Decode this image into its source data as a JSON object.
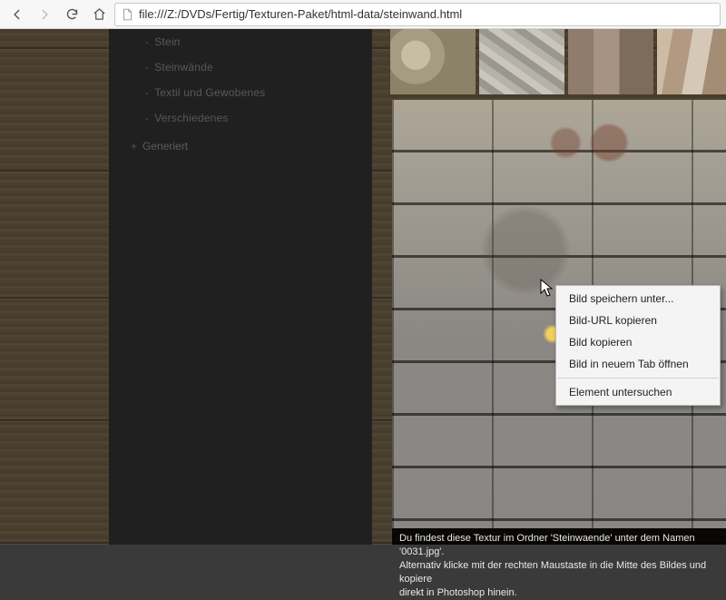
{
  "browser": {
    "url": "file:///Z:/DVDs/Fertig/Texturen-Paket/html-data/steinwand.html"
  },
  "sidebar": {
    "items": [
      "Stein",
      "Steinwände",
      "Textil und Gewobenes",
      "Verschiedenes"
    ],
    "category": "Generiert"
  },
  "caption": {
    "line1": "Du findest diese Textur im Ordner 'Steinwaende' unter dem Namen '0031.jpg'.",
    "line2": "Alternativ klicke mit der rechten Maustaste in die Mitte des Bildes und kopiere",
    "line3": "direkt in Photoshop hinein."
  },
  "context_menu": {
    "items": [
      "Bild speichern unter...",
      "Bild-URL kopieren",
      "Bild kopieren",
      "Bild in neuem Tab öffnen"
    ],
    "inspect": "Element untersuchen"
  }
}
